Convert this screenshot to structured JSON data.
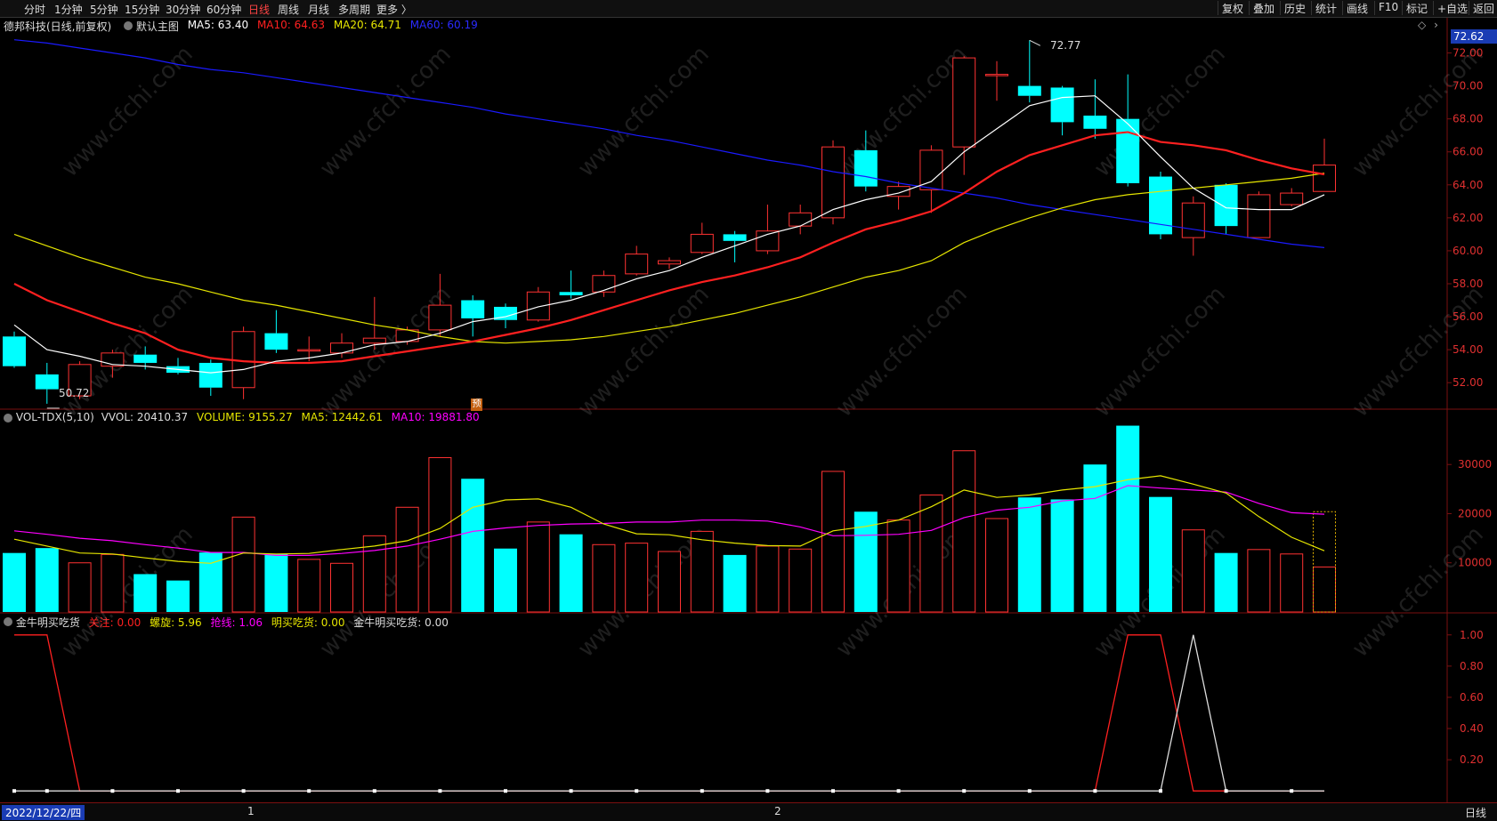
{
  "toolbar": {
    "periods": [
      "分时",
      "1分钟",
      "5分钟",
      "15分钟",
      "30分钟",
      "60分钟",
      "日线",
      "周线",
      "月线",
      "多周期",
      "更多 〉"
    ],
    "active": "日线",
    "right_buttons": [
      "复权",
      "叠加",
      "历史",
      "统计",
      "画线",
      "F10",
      "标记",
      "+自选",
      "返回"
    ]
  },
  "main_header": {
    "name": "德邦科技(日线,前复权)",
    "chart_label": "默认主图",
    "ma5": "MA5: 63.40",
    "ma10": "MA10: 64.63",
    "ma20": "MA20: 64.71",
    "ma60": "MA60: 60.19",
    "price_tag": "72.62",
    "high_label": "72.77",
    "low_label": "50.72",
    "pre_mark": "预"
  },
  "vol_header": {
    "name": "VOL-TDX(5,10)",
    "vvol": "VVOL: 20410.37",
    "volume": "VOLUME: 9155.27",
    "ma5": "MA5: 12442.61",
    "ma10": "MA10: 19881.80"
  },
  "ind_header": {
    "name": "金牛明买吃货",
    "guanzhu": "关注: 0.00",
    "luoxuan": "螺旋: 5.96",
    "qiangxian": "抢线: 1.06",
    "mingmai": "明买吃货: 0.00",
    "jinniu": "金牛明买吃货: 0.00"
  },
  "bottom": {
    "date": "2022/12/22/四",
    "month1": "1",
    "month2": "2",
    "period": "日线"
  },
  "colors": {
    "up": "#ff3232",
    "down": "#00ffff",
    "ma5": "#ffffff",
    "ma10": "#ff2020",
    "ma20": "#e6e600",
    "ma60": "#1a1aff",
    "vol_ma10": "#ff00ff",
    "grid": "#7a1010"
  },
  "chart_data": [
    {
      "type": "candlestick",
      "title": "德邦科技(日线,前复权)",
      "y_ticks": [
        "72.00",
        "70.00",
        "68.00",
        "66.00",
        "64.00",
        "62.00",
        "60.00",
        "58.00",
        "56.00",
        "54.00",
        "52.00"
      ],
      "ylim": [
        50.5,
        73.0
      ],
      "candles": [
        {
          "o": 54.8,
          "c": 53.0,
          "h": 55.1,
          "l": 52.9
        },
        {
          "o": 52.5,
          "c": 51.6,
          "h": 53.2,
          "l": 50.72
        },
        {
          "o": 51.2,
          "c": 53.1,
          "h": 53.3,
          "l": 51.0
        },
        {
          "o": 53.0,
          "c": 53.8,
          "h": 54.0,
          "l": 52.3
        },
        {
          "o": 53.7,
          "c": 53.2,
          "h": 54.2,
          "l": 52.8
        },
        {
          "o": 53.0,
          "c": 52.6,
          "h": 53.5,
          "l": 52.5
        },
        {
          "o": 53.2,
          "c": 51.7,
          "h": 53.4,
          "l": 51.2
        },
        {
          "o": 51.7,
          "c": 55.1,
          "h": 55.4,
          "l": 51.0
        },
        {
          "o": 55.0,
          "c": 54.0,
          "h": 56.4,
          "l": 53.8
        },
        {
          "o": 54.0,
          "c": 54.0,
          "h": 54.8,
          "l": 53.3
        },
        {
          "o": 53.8,
          "c": 54.4,
          "h": 55.0,
          "l": 53.5
        },
        {
          "o": 54.4,
          "c": 54.7,
          "h": 57.2,
          "l": 54.0
        },
        {
          "o": 54.5,
          "c": 55.2,
          "h": 55.4,
          "l": 54.3
        },
        {
          "o": 55.2,
          "c": 56.7,
          "h": 58.6,
          "l": 54.8
        },
        {
          "o": 57.0,
          "c": 55.9,
          "h": 57.3,
          "l": 54.8
        },
        {
          "o": 56.6,
          "c": 55.8,
          "h": 56.8,
          "l": 55.3
        },
        {
          "o": 55.8,
          "c": 57.5,
          "h": 57.8,
          "l": 55.7
        },
        {
          "o": 57.5,
          "c": 57.3,
          "h": 58.8,
          "l": 57.1
        },
        {
          "o": 57.5,
          "c": 58.5,
          "h": 58.8,
          "l": 57.2
        },
        {
          "o": 58.6,
          "c": 59.8,
          "h": 60.3,
          "l": 58.5
        },
        {
          "o": 59.2,
          "c": 59.4,
          "h": 59.6,
          "l": 58.9
        },
        {
          "o": 59.9,
          "c": 61.0,
          "h": 61.7,
          "l": 59.8
        },
        {
          "o": 61.0,
          "c": 60.6,
          "h": 61.2,
          "l": 59.3
        },
        {
          "o": 60.0,
          "c": 61.2,
          "h": 62.8,
          "l": 59.8
        },
        {
          "o": 61.5,
          "c": 62.3,
          "h": 62.8,
          "l": 61.0
        },
        {
          "o": 62.0,
          "c": 66.3,
          "h": 66.7,
          "l": 61.6
        },
        {
          "o": 66.1,
          "c": 63.9,
          "h": 67.3,
          "l": 63.6
        },
        {
          "o": 63.3,
          "c": 63.9,
          "h": 64.2,
          "l": 62.5
        },
        {
          "o": 63.7,
          "c": 66.1,
          "h": 66.4,
          "l": 62.3
        },
        {
          "o": 66.3,
          "c": 71.7,
          "h": 71.8,
          "l": 64.6
        },
        {
          "o": 70.7,
          "c": 70.7,
          "h": 71.5,
          "l": 69.1
        },
        {
          "o": 70.0,
          "c": 69.4,
          "h": 72.77,
          "l": 69.0
        },
        {
          "o": 69.9,
          "c": 67.8,
          "h": 70.0,
          "l": 67.0
        },
        {
          "o": 68.2,
          "c": 67.4,
          "h": 70.4,
          "l": 66.8
        },
        {
          "o": 68.0,
          "c": 64.1,
          "h": 70.7,
          "l": 63.9
        },
        {
          "o": 64.5,
          "c": 61.0,
          "h": 64.8,
          "l": 60.7
        },
        {
          "o": 60.8,
          "c": 62.9,
          "h": 63.3,
          "l": 59.7
        },
        {
          "o": 64.0,
          "c": 61.5,
          "h": 64.1,
          "l": 61.0
        },
        {
          "o": 60.8,
          "c": 63.4,
          "h": 63.6,
          "l": 60.8
        },
        {
          "o": 62.8,
          "c": 63.5,
          "h": 63.8,
          "l": 62.7
        },
        {
          "o": 63.6,
          "c": 65.2,
          "h": 66.8,
          "l": 63.6
        }
      ],
      "ma5": [
        55.5,
        54.0,
        53.6,
        53.1,
        53.0,
        52.8,
        52.6,
        52.8,
        53.3,
        53.5,
        53.8,
        54.3,
        54.5,
        55.0,
        55.7,
        56.0,
        56.6,
        57.0,
        57.6,
        58.3,
        58.8,
        59.6,
        60.3,
        61.0,
        61.5,
        62.5,
        63.1,
        63.5,
        64.2,
        66.0,
        67.4,
        68.8,
        69.3,
        69.4,
        67.7,
        65.7,
        63.8,
        62.6,
        62.5,
        62.5,
        63.4
      ],
      "ma10": [
        58.0,
        57.0,
        56.3,
        55.6,
        55.0,
        54.0,
        53.5,
        53.3,
        53.2,
        53.2,
        53.3,
        53.6,
        53.9,
        54.2,
        54.5,
        54.9,
        55.3,
        55.8,
        56.4,
        57.0,
        57.6,
        58.1,
        58.5,
        59.0,
        59.6,
        60.5,
        61.3,
        61.8,
        62.4,
        63.5,
        64.8,
        65.8,
        66.4,
        67.0,
        67.2,
        66.6,
        66.4,
        66.1,
        65.5,
        65.0,
        64.63
      ],
      "ma20": [
        61.0,
        60.3,
        59.6,
        59.0,
        58.4,
        58.0,
        57.5,
        57.0,
        56.7,
        56.3,
        55.9,
        55.5,
        55.2,
        54.8,
        54.5,
        54.4,
        54.5,
        54.6,
        54.8,
        55.1,
        55.4,
        55.8,
        56.2,
        56.7,
        57.2,
        57.8,
        58.4,
        58.8,
        59.4,
        60.5,
        61.3,
        62.0,
        62.6,
        63.1,
        63.4,
        63.6,
        63.8,
        64.0,
        64.2,
        64.4,
        64.71
      ],
      "ma60": [
        72.8,
        72.6,
        72.3,
        72.0,
        71.7,
        71.3,
        71.0,
        70.8,
        70.5,
        70.2,
        69.9,
        69.6,
        69.3,
        69.0,
        68.7,
        68.3,
        68.0,
        67.7,
        67.4,
        67.0,
        66.7,
        66.3,
        65.9,
        65.5,
        65.2,
        64.8,
        64.5,
        64.1,
        63.8,
        63.5,
        63.2,
        62.8,
        62.5,
        62.2,
        61.9,
        61.6,
        61.3,
        61.0,
        60.7,
        60.4,
        60.19
      ]
    },
    {
      "type": "bar",
      "title": "VOL-TDX(5,10)",
      "y_ticks": [
        "30000",
        "20000",
        "10000"
      ],
      "ylim": [
        0,
        38000
      ],
      "volumes": [
        12000,
        13000,
        10000,
        11700,
        7700,
        6400,
        12100,
        19300,
        11800,
        10700,
        9900,
        15500,
        21300,
        31400,
        27100,
        12900,
        18300,
        15800,
        13700,
        14000,
        12300,
        16400,
        11600,
        13400,
        12800,
        28600,
        20400,
        18700,
        23800,
        32800,
        19000,
        23300,
        22900,
        30000,
        37900,
        23400,
        16700,
        12000,
        12700,
        11800,
        9155.27
      ],
      "vol_ma5": [
        14800,
        13400,
        12000,
        11800,
        11000,
        10300,
        9900,
        12000,
        11800,
        11900,
        12700,
        13400,
        14500,
        17000,
        21300,
        22800,
        23000,
        21300,
        17900,
        15900,
        15700,
        14700,
        14000,
        13500,
        13400,
        16500,
        17400,
        18700,
        21400,
        24800,
        23300,
        23800,
        24800,
        25500,
        26900,
        27700,
        26000,
        24200,
        19400,
        15200,
        12442.61
      ],
      "vol_ma10": [
        16500,
        15800,
        15000,
        14500,
        13700,
        13000,
        12100,
        12100,
        11500,
        11500,
        11900,
        12500,
        13400,
        14800,
        16400,
        17100,
        17600,
        17900,
        18000,
        18300,
        18300,
        18700,
        18700,
        18500,
        17300,
        15500,
        15600,
        15800,
        16600,
        19200,
        20700,
        21300,
        22600,
        23100,
        25700,
        25200,
        24800,
        24400,
        22100,
        20200,
        19881.8
      ]
    },
    {
      "type": "line",
      "title": "金牛明买吃货",
      "y_ticks": [
        "1.00",
        "0.80",
        "0.60",
        "0.40",
        "0.20"
      ],
      "ylim": [
        -0.05,
        1.05
      ],
      "series": [
        {
          "name": "关注",
          "values": [
            1,
            1,
            0,
            0,
            0,
            0,
            0,
            0,
            0,
            0,
            0,
            0,
            0,
            0,
            0,
            0,
            0,
            0,
            0,
            0,
            0,
            0,
            0,
            0,
            0,
            0,
            0,
            0,
            0,
            0,
            0,
            0,
            0,
            0,
            1,
            1,
            0,
            0,
            0,
            0,
            0
          ]
        },
        {
          "name": "金牛明买吃货",
          "values": [
            0,
            0,
            0,
            0,
            0,
            0,
            0,
            0,
            0,
            0,
            0,
            0,
            0,
            0,
            0,
            0,
            0,
            0,
            0,
            0,
            0,
            0,
            0,
            0,
            0,
            0,
            0,
            0,
            0,
            0,
            0,
            0,
            0,
            0,
            0,
            0,
            1,
            0,
            0,
            0,
            0
          ]
        }
      ]
    }
  ]
}
